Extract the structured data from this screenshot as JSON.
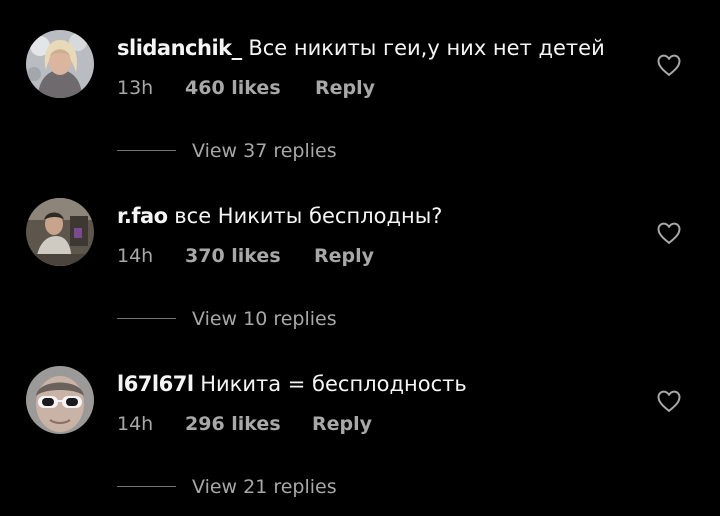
{
  "comments": [
    {
      "username": "slidanchik_",
      "text": "Все никиты геи,у них нет детей",
      "time": "13h",
      "likes": "460 likes",
      "reply_label": "Reply",
      "view_replies": "View 37 replies"
    },
    {
      "username": "r.fao",
      "text": "все Никиты бесплодны?",
      "time": "14h",
      "likes": "370 likes",
      "reply_label": "Reply",
      "view_replies": "View 10 replies"
    },
    {
      "username": "l67l67l",
      "text": "Никита = бесплодность",
      "time": "14h",
      "likes": "296 likes",
      "reply_label": "Reply",
      "view_replies": "View 21 replies"
    }
  ],
  "colors": {
    "background": "#000000",
    "primary_text": "#f5f5f5",
    "secondary_text": "#a8a8a8",
    "divider": "#737373"
  },
  "icons": {
    "like": "heart-outline-icon"
  }
}
